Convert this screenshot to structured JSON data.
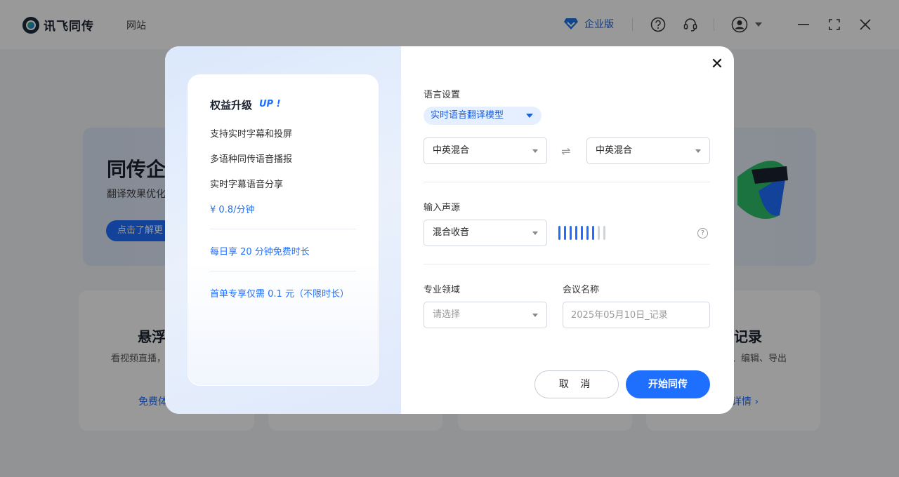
{
  "app": {
    "name": "讯飞同传",
    "nav_site": "网站",
    "edition": "企业版"
  },
  "background": {
    "banner_title": "同传企",
    "banner_sub": "翻译效果优化",
    "banner_button": "点击了解更",
    "cards": [
      {
        "title": "悬浮",
        "desc": "看视频直播，",
        "link": "免费体"
      },
      {
        "title": "记录",
        "desc": "、编辑、导出",
        "link": "详情 ›"
      }
    ]
  },
  "modal": {
    "benefits": {
      "title": "权益升级",
      "badge": "UP !",
      "features": [
        "支持实时字幕和投屏",
        "多语种同传语音播报",
        "实时字幕语音分享"
      ],
      "price": "¥ 0.8/分钟",
      "daily": "每日享 20 分钟免费时长",
      "first_order": "首单专享仅需 0.1 元（不限时长）"
    },
    "language": {
      "label": "语言设置",
      "model": "实时语音翻译模型",
      "source": "中英混合",
      "target": "中英混合",
      "swap": "⇌"
    },
    "input": {
      "label": "输入声源",
      "source": "混合收音",
      "level_active": 7,
      "level_total": 9
    },
    "domain": {
      "label": "专业领域",
      "placeholder": "请选择"
    },
    "meeting": {
      "label": "会议名称",
      "placeholder": "2025年05月10日_记录"
    },
    "buttons": {
      "cancel": "取 消",
      "start": "开始同传"
    },
    "close": "✕"
  }
}
